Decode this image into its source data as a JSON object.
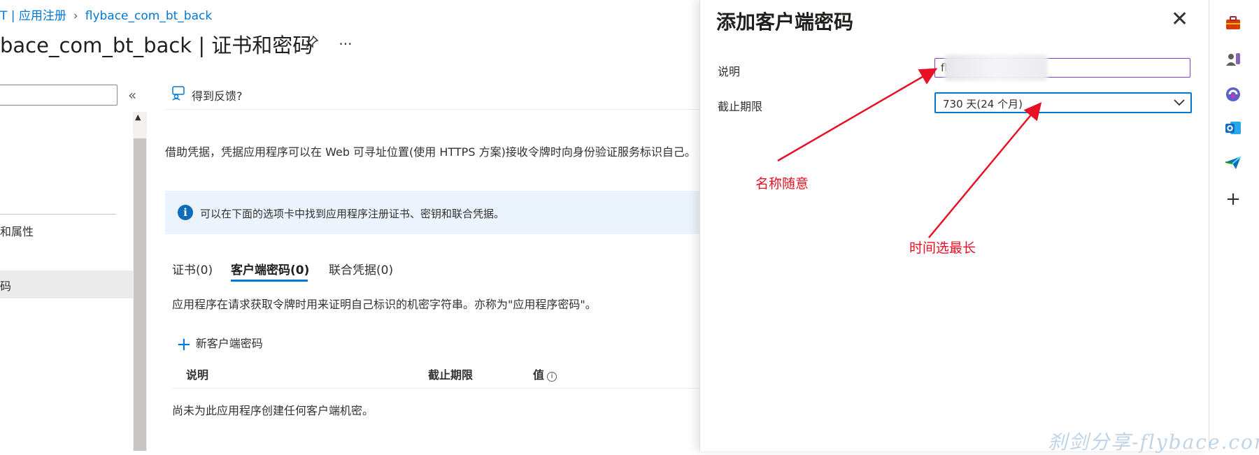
{
  "breadcrumb": {
    "parent": "T | 应用注册",
    "current": "flybace_com_bt_back"
  },
  "page": {
    "title": "bace_com_bt_back | 证书和密码",
    "pin_icon": "pin-icon",
    "more": "···"
  },
  "nav": {
    "collapse": "«",
    "items": [
      {
        "label": "和属性"
      },
      {
        "label": "码"
      }
    ]
  },
  "toolbar": {
    "feedback": "得到反馈?"
  },
  "content": {
    "description": "借助凭据，凭据应用程序可以在 Web 可寻址位置(使用 HTTPS 方案)接收令牌时向身份验证服务标识自己。为",
    "info": "可以在下面的选项卡中找到应用程序注册证书、密钥和联合凭据。",
    "tabs": [
      {
        "label": "证书(0)"
      },
      {
        "label": "客户端密码(0)"
      },
      {
        "label": "联合凭据(0)"
      }
    ],
    "tab_description": "应用程序在请求获取令牌时用来证明自己标识的机密字符串。亦称为\"应用程序密码\"。",
    "add_button": "新客户端密码",
    "columns": [
      "说明",
      "截止期限",
      "值"
    ],
    "empty_message": "尚未为此应用程序创建任何客户端机密。"
  },
  "panel": {
    "title": "添加客户端密码",
    "close": "✕",
    "description_label": "说明",
    "description_value": "fl",
    "expiry_label": "截止期限",
    "expiry_value": "730 天(24 个月)"
  },
  "annotations": {
    "name_note": "名称随意",
    "time_note": "时间选最长"
  },
  "watermark": "刹剑分享-flybace.com",
  "colors": {
    "accent": "#0078d4",
    "annotation": "#e81123",
    "info_bg": "#ebf3fc",
    "input_focus": "#8a3ad3"
  }
}
